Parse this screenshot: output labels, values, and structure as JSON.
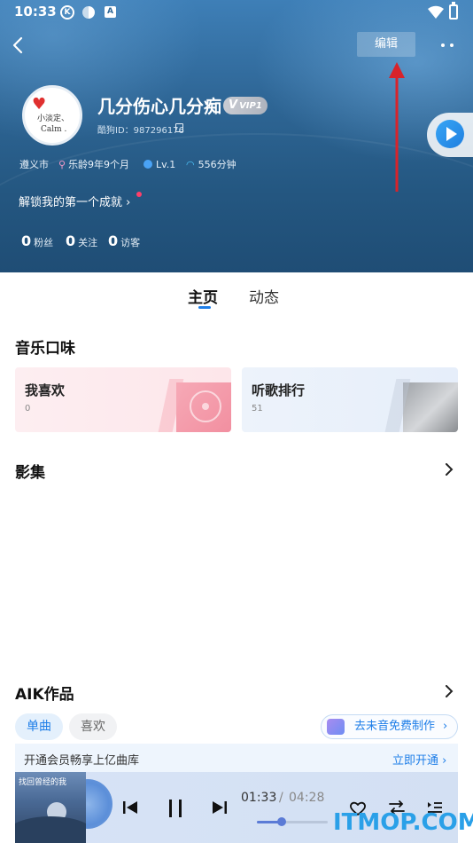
{
  "status_bar": {
    "time": "10:33",
    "icon_k": "K",
    "icon_a": "A"
  },
  "header": {
    "edit_label": "编辑",
    "nickname": "几分伤心几分痴",
    "vip_v": "V",
    "vip_label": "VIP1",
    "kugou_id": "酷狗ID：987296176",
    "avatar_line1": "小淡定、",
    "avatar_line2": "Calm .",
    "info": {
      "city": "遵义市",
      "music_age": "乐龄9年9个月",
      "level": "Lv.1",
      "listen_time": "556分钟"
    },
    "achievement": "解锁我的第一个成就",
    "achievement_chevron": "›",
    "stats": [
      {
        "value": "0",
        "label": "粉丝"
      },
      {
        "value": "0",
        "label": "关注"
      },
      {
        "value": "0",
        "label": "访客"
      }
    ]
  },
  "tabs": {
    "home": "主页",
    "feed": "动态"
  },
  "music_taste": {
    "title": "音乐口味",
    "cards": [
      {
        "title": "我喜欢",
        "count": "0"
      },
      {
        "title": "听歌排行",
        "count": "51"
      }
    ]
  },
  "album_section": {
    "title": "影集"
  },
  "aik_section": {
    "title": "AIK作品",
    "chips": [
      "单曲",
      "喜欢"
    ],
    "make_button": "去未音免费制作",
    "make_chevron": "›"
  },
  "vip_banner": {
    "text": "开通会员畅享上亿曲库",
    "action": "立即开通 ›"
  },
  "player": {
    "album_title": "找回曾经的我",
    "current_time": "01:33",
    "separator": "/",
    "total_time": "04:28",
    "progress": 0.35
  },
  "watermark": {
    "text": "ITMOP.COM"
  },
  "colors": {
    "accent": "#1e7ee8",
    "header": "#2f6797",
    "arrow": "#d8232a"
  }
}
